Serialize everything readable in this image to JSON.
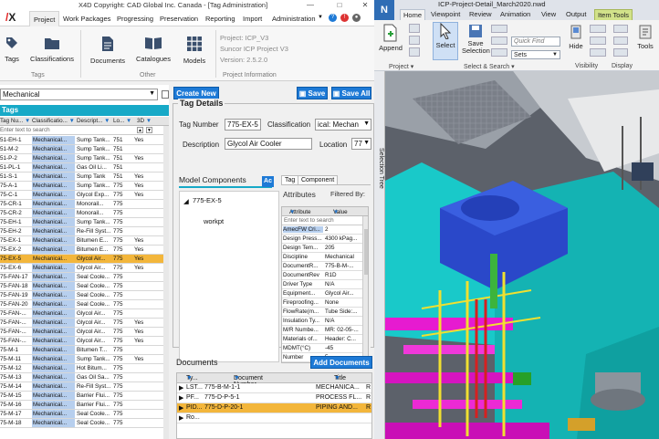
{
  "x4d": {
    "title": "X4D Copyright: CAD Global Inc. Canada - [Tag Administration]",
    "menu": [
      "Project",
      "Work Packages",
      "Progressing",
      "Preservation",
      "Reporting",
      "Import",
      "Administration"
    ],
    "logo": "X",
    "ribbon": {
      "buttons": {
        "tags": "Tags",
        "classifications": "Classifications",
        "documents": "Documents",
        "catalogues": "Catalogues",
        "models": "Models"
      },
      "groups": {
        "tags": "Tags",
        "other": "Other",
        "project_info": "Project Information"
      },
      "project_info": [
        "Project: ICP_V3",
        "Suncor ICP Project V3",
        "Version: 2.5.2.0"
      ]
    },
    "list": {
      "combo_value": "Mechanical",
      "header": "Tags",
      "columns": [
        "Tag Nu...",
        "Classificatio...",
        "Descript...",
        "Lo...",
        "3D"
      ],
      "filter_placeholder": "Enter text to search",
      "rows": [
        [
          "51-EH-1",
          "Mechanical...",
          "Sump Tank...",
          "751",
          "Yes"
        ],
        [
          "51-M-2",
          "Mechanical...",
          "Sump Tank...",
          "751",
          ""
        ],
        [
          "51-P-2",
          "Mechanical...",
          "Sump Tank...",
          "751",
          "Yes"
        ],
        [
          "51-PL-1",
          "Mechanical...",
          "Gas Oil Li...",
          "751",
          ""
        ],
        [
          "51-S-1",
          "Mechanical...",
          "Sump Tank",
          "751",
          "Yes"
        ],
        [
          "75-A-1",
          "Mechanical...",
          "Sump Tank...",
          "775",
          "Yes"
        ],
        [
          "75-C-1",
          "Mechanical...",
          "Glycol Exp...",
          "775",
          "Yes"
        ],
        [
          "75-CR-1",
          "Mechanical...",
          "Monorail...",
          "775",
          ""
        ],
        [
          "75-CR-2",
          "Mechanical...",
          "Monorail...",
          "775",
          ""
        ],
        [
          "75-EH-1",
          "Mechanical...",
          "Sump Tank...",
          "775",
          ""
        ],
        [
          "75-EH-2",
          "Mechanical...",
          "Re-Fill Syst...",
          "775",
          ""
        ],
        [
          "75-EX-1",
          "Mechanical...",
          "Bitumen E...",
          "775",
          "Yes"
        ],
        [
          "75-EX-2",
          "Mechanical...",
          "Bitumen E...",
          "775",
          "Yes"
        ],
        [
          "75-EX-5",
          "Mechanical...",
          "Glycol Air...",
          "775",
          "Yes"
        ],
        [
          "75-EX-6",
          "Mechanical...",
          "Glycol Air...",
          "775",
          "Yes"
        ],
        [
          "75-FAN-17",
          "Mechanical...",
          "Seal Coole...",
          "775",
          ""
        ],
        [
          "75-FAN-18",
          "Mechanical...",
          "Seal Coole...",
          "775",
          ""
        ],
        [
          "75-FAN-19",
          "Mechanical...",
          "Seal Coole...",
          "775",
          ""
        ],
        [
          "75-FAN-20",
          "Mechanical...",
          "Seal Coole...",
          "775",
          ""
        ],
        [
          "75-FAN-...",
          "Mechanical...",
          "Glycol Air...",
          "775",
          ""
        ],
        [
          "75-FAN-...",
          "Mechanical...",
          "Glycol Air...",
          "775",
          "Yes"
        ],
        [
          "75-FAN-...",
          "Mechanical...",
          "Glycol Air...",
          "775",
          "Yes"
        ],
        [
          "75-FAN-...",
          "Mechanical...",
          "Glycol Air...",
          "775",
          "Yes"
        ],
        [
          "75-M-1",
          "Mechanical...",
          "Bitumen T...",
          "775",
          ""
        ],
        [
          "75-M-11",
          "Mechanical...",
          "Sump Tank...",
          "775",
          "Yes"
        ],
        [
          "75-M-12",
          "Mechanical...",
          "Hot Bitum...",
          "775",
          ""
        ],
        [
          "75-M-13",
          "Mechanical...",
          "Gas Oil Sa...",
          "775",
          ""
        ],
        [
          "75-M-14",
          "Mechanical...",
          "Re-Fill Syst...",
          "775",
          ""
        ],
        [
          "75-M-15",
          "Mechanical...",
          "Barrier Flui...",
          "775",
          ""
        ],
        [
          "75-M-16",
          "Mechanical...",
          "Barrier Flui...",
          "775",
          ""
        ],
        [
          "75-M-17",
          "Mechanical...",
          "Seal Coole...",
          "775",
          ""
        ],
        [
          "75-M-18",
          "Mechanical...",
          "Seal Coole...",
          "775",
          ""
        ]
      ],
      "selected_index": 13
    },
    "detail": {
      "create_new": "Create New",
      "save": "Save",
      "save_all": "Save All",
      "group_title": "Tag Details",
      "tag_number_label": "Tag Number",
      "tag_number": "775-EX-5",
      "classification_label": "Classification",
      "classification": "ical: Mechan",
      "description_label": "Description",
      "description": "Glycol Air Cooler",
      "location_label": "Location",
      "location": "77",
      "model_components": "Model Components",
      "model_tab": "Ac",
      "tree_root": "775-EX-5",
      "tree_child": "workpt",
      "attr_tabs": [
        "Tag",
        "Component"
      ],
      "attributes_title": "Attributes",
      "filtered_by": "Filtered By:",
      "attr_cols": [
        "Attribute",
        "Value"
      ],
      "attr_filter": "Enter text to search",
      "attributes": [
        [
          "AmecFW Cri...",
          "2"
        ],
        [
          "Design Press...",
          "4300 kPag..."
        ],
        [
          "Design Tem...",
          "205"
        ],
        [
          "Discipline",
          "Mechanical"
        ],
        [
          "DocumentR...",
          "775-B-M-..."
        ],
        [
          "DocumentRev",
          "R1D"
        ],
        [
          "Driver Type",
          "N/A"
        ],
        [
          "Equipment...",
          "Glycol Air..."
        ],
        [
          "Fireproofing...",
          "None"
        ],
        [
          "FlowRate(m...",
          "Tube Side:..."
        ],
        [
          "Insulation Ty...",
          "N/A"
        ],
        [
          "M/R Numbe...",
          "MR: 02-05-..."
        ],
        [
          "Materials of...",
          "Header: C..."
        ],
        [
          "MDMT(°C)",
          "-45"
        ],
        [
          "Number",
          "5"
        ]
      ],
      "documents_title": "Documents",
      "add_documents": "Add Documents",
      "doc_cols": [
        "Ty...",
        "Document Number",
        "Title"
      ],
      "docs": [
        [
          "LST...",
          "775-B-M-1-1",
          "MECHANICA...",
          "R"
        ],
        [
          "PF...",
          "775-D-P-5-1",
          "PROCESS FL...",
          "R"
        ],
        [
          "PID...",
          "775-D-P-20-1",
          "PIPING AND...",
          "R"
        ],
        [
          "Ro...",
          "",
          "",
          ""
        ]
      ],
      "selected_doc": 2
    }
  },
  "navis": {
    "title": "ICP-Project-Detail_March2020.nwd",
    "logo": "N",
    "tabs": [
      "Home",
      "Viewpoint",
      "Review",
      "Animation",
      "View",
      "Output",
      "Item Tools"
    ],
    "buttons": {
      "append": "Append",
      "select": "Select",
      "save_selection": "Save Selection",
      "hide": "Hide",
      "tools": "Tools"
    },
    "quick_find": "Quick Find",
    "sets": "Sets",
    "groups": [
      "Project",
      "Select & Search",
      "Visibility",
      "Display"
    ],
    "side_label": "Selection Tree"
  },
  "colors": {
    "accent": "#17a9c7",
    "blue": "#1e7ad6",
    "selected": "#f3b63b",
    "cell": "#b7cfee"
  }
}
